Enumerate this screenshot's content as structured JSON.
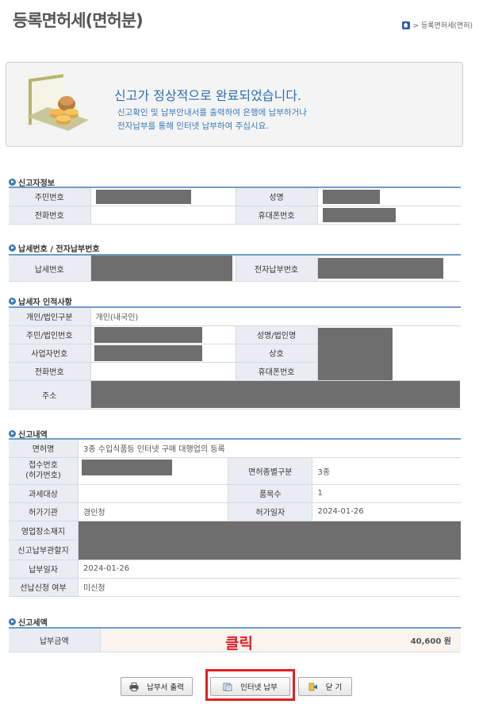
{
  "page": {
    "title": "등록면허세(면허분)",
    "breadcrumb": "> 등록면허세(면허)"
  },
  "notice": {
    "title": "신고가 정상적으로 완료되었습니다.",
    "line1": "신고확인 및 납부안내서를 출력하여 은행에 납부하거나",
    "line2": "전자납부를 통해 인터넷 납부하여 주십시요."
  },
  "reporter": {
    "section_title": "신고자정보",
    "labels": {
      "resident_no": "주민번호",
      "name": "성명",
      "phone": "전화번호",
      "mobile": "휴대폰번호"
    }
  },
  "tax_no": {
    "section_title": "납세번호 / 전자납부번호",
    "labels": {
      "tax_no": "납세번호",
      "epay_no": "전자납부번호"
    }
  },
  "taxpayer": {
    "section_title": "납세자 인적사항",
    "labels": {
      "type": "개인/법인구분",
      "resident_corp_no": "주민/법인번호",
      "name_corp": "성명/법인명",
      "business_no": "사업자번호",
      "trade_name": "상호",
      "phone": "전화번호",
      "mobile": "휴대폰번호",
      "address": "주소"
    },
    "values": {
      "type": "개인(내국인)"
    }
  },
  "report": {
    "section_title": "신고내역",
    "labels": {
      "license_name": "면허명",
      "receipt_no": "접수번호\n(허가번호)",
      "license_class": "면허종별구분",
      "taxable": "과세대상",
      "count": "품목수",
      "authority": "허가기관",
      "permit_date": "허가일자",
      "business_addr": "영업장소재지",
      "jurisdiction": "신고납부관할지",
      "pay_date": "납부일자",
      "prepay": "선납신청 여부"
    },
    "values": {
      "license_name": "3종 수입식품등 인터넷 구매 대행업의 등록",
      "license_class": "3종",
      "count": "1",
      "authority": "경인청",
      "permit_date": "2024-01-26",
      "pay_date": "2024-01-26",
      "prepay": "미신청"
    }
  },
  "tax_amount": {
    "section_title": "신고세액",
    "label": "납부금액",
    "value": "40,600 원"
  },
  "annotation": {
    "click_label": "클릭"
  },
  "buttons": {
    "print": "납부서 출력",
    "internet_pay": "인터넷 납부",
    "close": "닫 기"
  }
}
